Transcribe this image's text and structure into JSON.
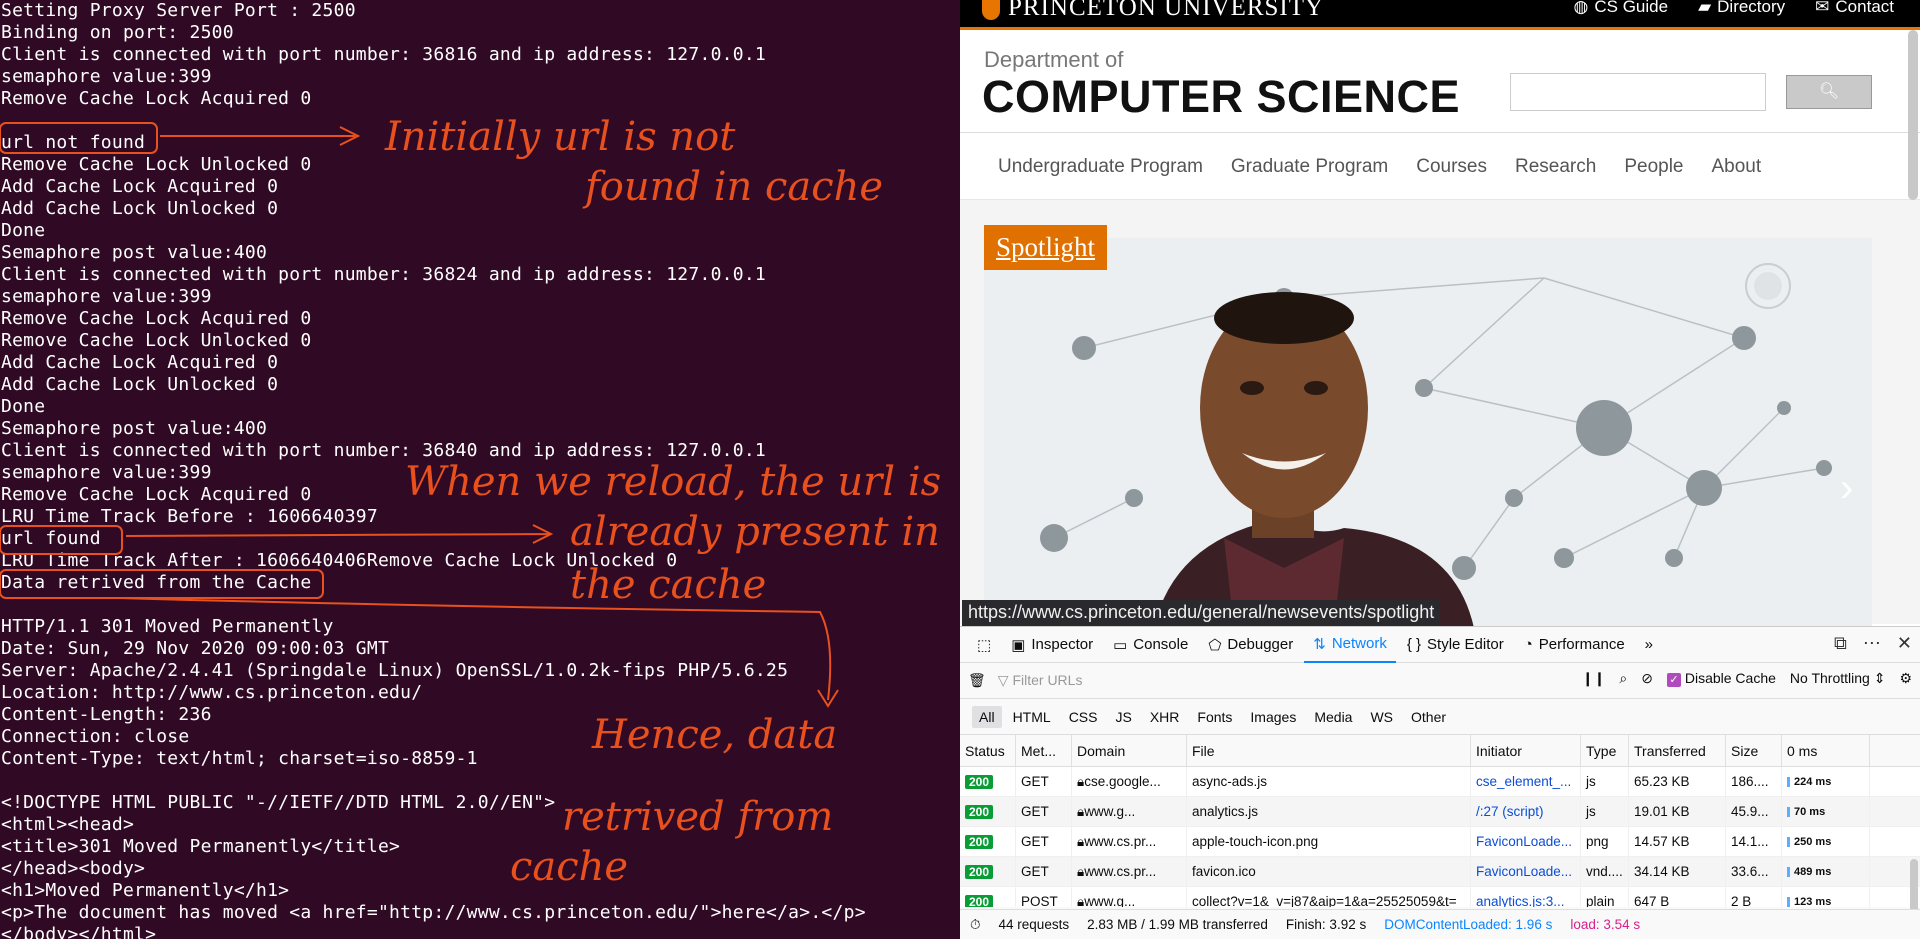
{
  "terminal": {
    "lines": [
      "Setting Proxy Server Port : 2500",
      "Binding on port: 2500",
      "Client is connected with port number: 36816 and ip address: 127.0.0.1",
      "semaphore value:399",
      "Remove Cache Lock Acquired 0",
      "",
      "url not found",
      "Remove Cache Lock Unlocked 0",
      "Add Cache Lock Acquired 0",
      "Add Cache Lock Unlocked 0",
      "Done",
      "Semaphore post value:400",
      "Client is connected with port number: 36824 and ip address: 127.0.0.1",
      "semaphore value:399",
      "Remove Cache Lock Acquired 0",
      "Remove Cache Lock Unlocked 0",
      "Add Cache Lock Acquired 0",
      "Add Cache Lock Unlocked 0",
      "Done",
      "Semaphore post value:400",
      "Client is connected with port number: 36840 and ip address: 127.0.0.1",
      "semaphore value:399",
      "Remove Cache Lock Acquired 0",
      "LRU Time Track Before : 1606640397",
      "url found",
      "LRU Time Track After : 1606640406Remove Cache Lock Unlocked 0",
      "Data retrived from the Cache",
      "",
      "HTTP/1.1 301 Moved Permanently",
      "Date: Sun, 29 Nov 2020 09:00:03 GMT",
      "Server: Apache/2.4.41 (Springdale Linux) OpenSSL/1.0.2k-fips PHP/5.6.25",
      "Location: http://www.cs.princeton.edu/",
      "Content-Length: 236",
      "Connection: close",
      "Content-Type: text/html; charset=iso-8859-1",
      "",
      "<!DOCTYPE HTML PUBLIC \"-//IETF//DTD HTML 2.0//EN\">",
      "<html><head>",
      "<title>301 Moved Permanently</title>",
      "</head><body>",
      "<h1>Moved Permanently</h1>",
      "<p>The document has moved <a href=\"http://www.cs.princeton.edu/\">here</a>.</p>",
      "</body></html>"
    ],
    "annotations": {
      "note1_line1": "Initially url is not",
      "note1_line2": "found in cache",
      "note2_line1": "When we reload, the url is",
      "note2_line2": "already present in",
      "note2_line3": "the cache",
      "note3_line1": "Hence, data",
      "note3_line2": "retrived from",
      "note3_line3": "cache"
    },
    "annotation_color": "#e8501e"
  },
  "browser": {
    "university": "PRINCETON UNIVERSITY",
    "top_links": [
      {
        "icon": "globe-icon",
        "label": "CS Guide"
      },
      {
        "icon": "folder-icon",
        "label": "Directory"
      },
      {
        "icon": "envelope-icon",
        "label": "Contact"
      }
    ],
    "dept_of": "Department of",
    "dept_name": "COMPUTER SCIENCE",
    "nav": [
      "Undergraduate Program",
      "Graduate Program",
      "Courses",
      "Research",
      "People",
      "About"
    ],
    "spotlight_label": "Spotlight",
    "status_url": "https://www.cs.princeton.edu/general/newsevents/spotlight",
    "accent_color": "#e07000"
  },
  "devtools": {
    "tabs": [
      "Inspector",
      "Console",
      "Debugger",
      "Network",
      "Style Editor",
      "Performance"
    ],
    "active_tab": "Network",
    "filter_placeholder": "Filter URLs",
    "disable_cache_label": "Disable Cache",
    "throttling": "No Throttling",
    "type_filters": [
      "All",
      "HTML",
      "CSS",
      "JS",
      "XHR",
      "Fonts",
      "Images",
      "Media",
      "WS",
      "Other"
    ],
    "columns": [
      "Status",
      "Met...",
      "Domain",
      "File",
      "Initiator",
      "Type",
      "Transferred",
      "Size",
      "0 ms"
    ],
    "rows": [
      {
        "status": "200",
        "method": "GET",
        "domain": "cse.google...",
        "file": "async-ads.js",
        "initiator": "cse_element_...",
        "type": "js",
        "transferred": "65.23 KB",
        "size": "186....",
        "time": "224 ms"
      },
      {
        "status": "200",
        "method": "GET",
        "domain": "www.g...",
        "file": "analytics.js",
        "initiator": "/:27 (script)",
        "type": "js",
        "transferred": "19.01 KB",
        "size": "45.9...",
        "time": "70 ms"
      },
      {
        "status": "200",
        "method": "GET",
        "domain": "www.cs.pr...",
        "file": "apple-touch-icon.png",
        "initiator": "FaviconLoade...",
        "type": "png",
        "transferred": "14.57 KB",
        "size": "14.1...",
        "time": "250 ms"
      },
      {
        "status": "200",
        "method": "GET",
        "domain": "www.cs.pr...",
        "file": "favicon.ico",
        "initiator": "FaviconLoade...",
        "type": "vnd....",
        "transferred": "34.14 KB",
        "size": "33.6...",
        "time": "489 ms"
      },
      {
        "status": "200",
        "method": "POST",
        "domain": "www.g...",
        "file": "collect?v=1&_v=j87&aip=1&a=25525059&t=",
        "initiator": "analytics.js:3...",
        "type": "plain",
        "transferred": "647 B",
        "size": "2 B",
        "time": "123 ms"
      }
    ],
    "summary": {
      "requests": "44 requests",
      "transferred": "2.83 MB / 1.99 MB transferred",
      "finish": "Finish: 3.92 s",
      "domcontentloaded": "DOMContentLoaded: 1.96 s",
      "load": "load: 3.54 s"
    }
  }
}
